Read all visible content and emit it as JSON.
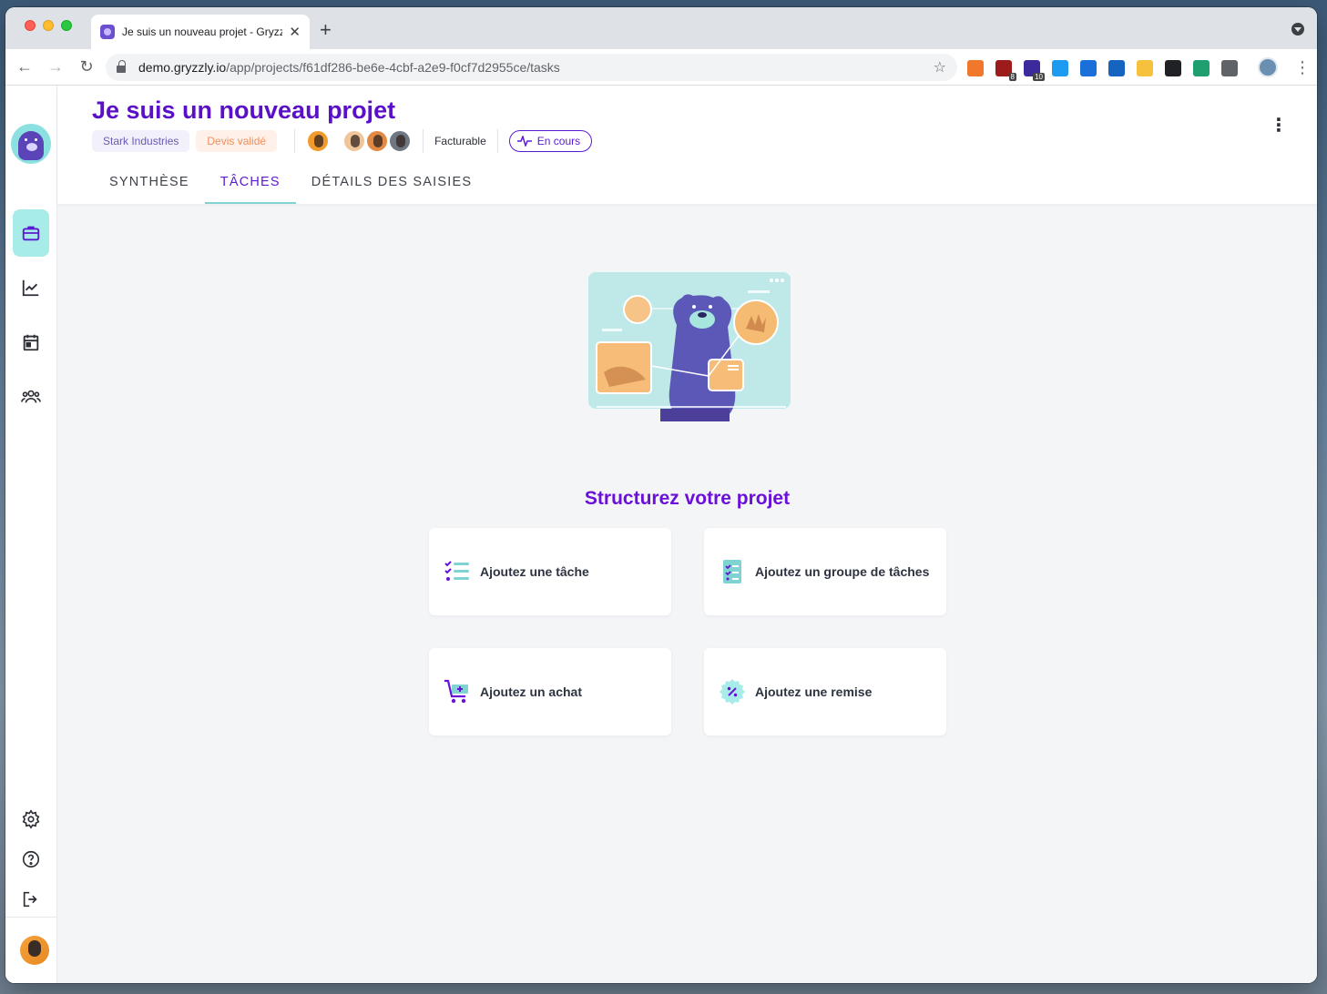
{
  "browser": {
    "tab_title": "Je suis un nouveau projet - Gryzzly",
    "url_host": "demo.gryzzly.io",
    "url_path": "/app/projects/f61df286-be6e-4cbf-a2e9-f0cf7d2955ce/tasks",
    "extensions": [
      {
        "icon": "hubspot-icon",
        "color": "#f0772b",
        "badge": ""
      },
      {
        "icon": "ublock-icon",
        "color": "#9e1b1b",
        "badge": "8"
      },
      {
        "icon": "graduation-cap-icon",
        "color": "#3b2a9b",
        "badge": "10"
      },
      {
        "icon": "notion-n-icon",
        "color": "#1d9bf0",
        "badge": ""
      },
      {
        "icon": "onepassword-icon",
        "color": "#1a6fd8",
        "badge": ""
      },
      {
        "icon": "v-icon",
        "color": "#1565c0",
        "badge": ""
      },
      {
        "icon": "lightbulb-icon",
        "color": "#f6c23e",
        "badge": ""
      },
      {
        "icon": "cube-icon",
        "color": "#202124",
        "badge": ""
      },
      {
        "icon": "arrow-ext-icon",
        "color": "#1f9e6f",
        "badge": ""
      },
      {
        "icon": "puzzle-icon",
        "color": "#5f6368",
        "badge": ""
      }
    ]
  },
  "header": {
    "project_title": "Je suis un nouveau projet",
    "client": "Stark Industries",
    "quote_status": "Devis validé",
    "billing": "Facturable",
    "status": "En cours"
  },
  "tabs": [
    {
      "label": "Synthèse",
      "active": false
    },
    {
      "label": "Tâches",
      "active": true
    },
    {
      "label": "Détails des saisies",
      "active": false
    }
  ],
  "empty_state": {
    "title": "Structurez votre projet",
    "actions": [
      {
        "label": "Ajoutez une tâche",
        "icon": "task-list-icon"
      },
      {
        "label": "Ajoutez un groupe de tâches",
        "icon": "task-group-icon"
      },
      {
        "label": "Ajoutez un achat",
        "icon": "cart-add-icon"
      },
      {
        "label": "Ajoutez une remise",
        "icon": "discount-badge-icon"
      }
    ]
  },
  "colors": {
    "brand": "#5a0fc8",
    "accent": "#7fd4d1",
    "sidebar_active": "#a8ece9",
    "background": "#f4f5f7"
  }
}
